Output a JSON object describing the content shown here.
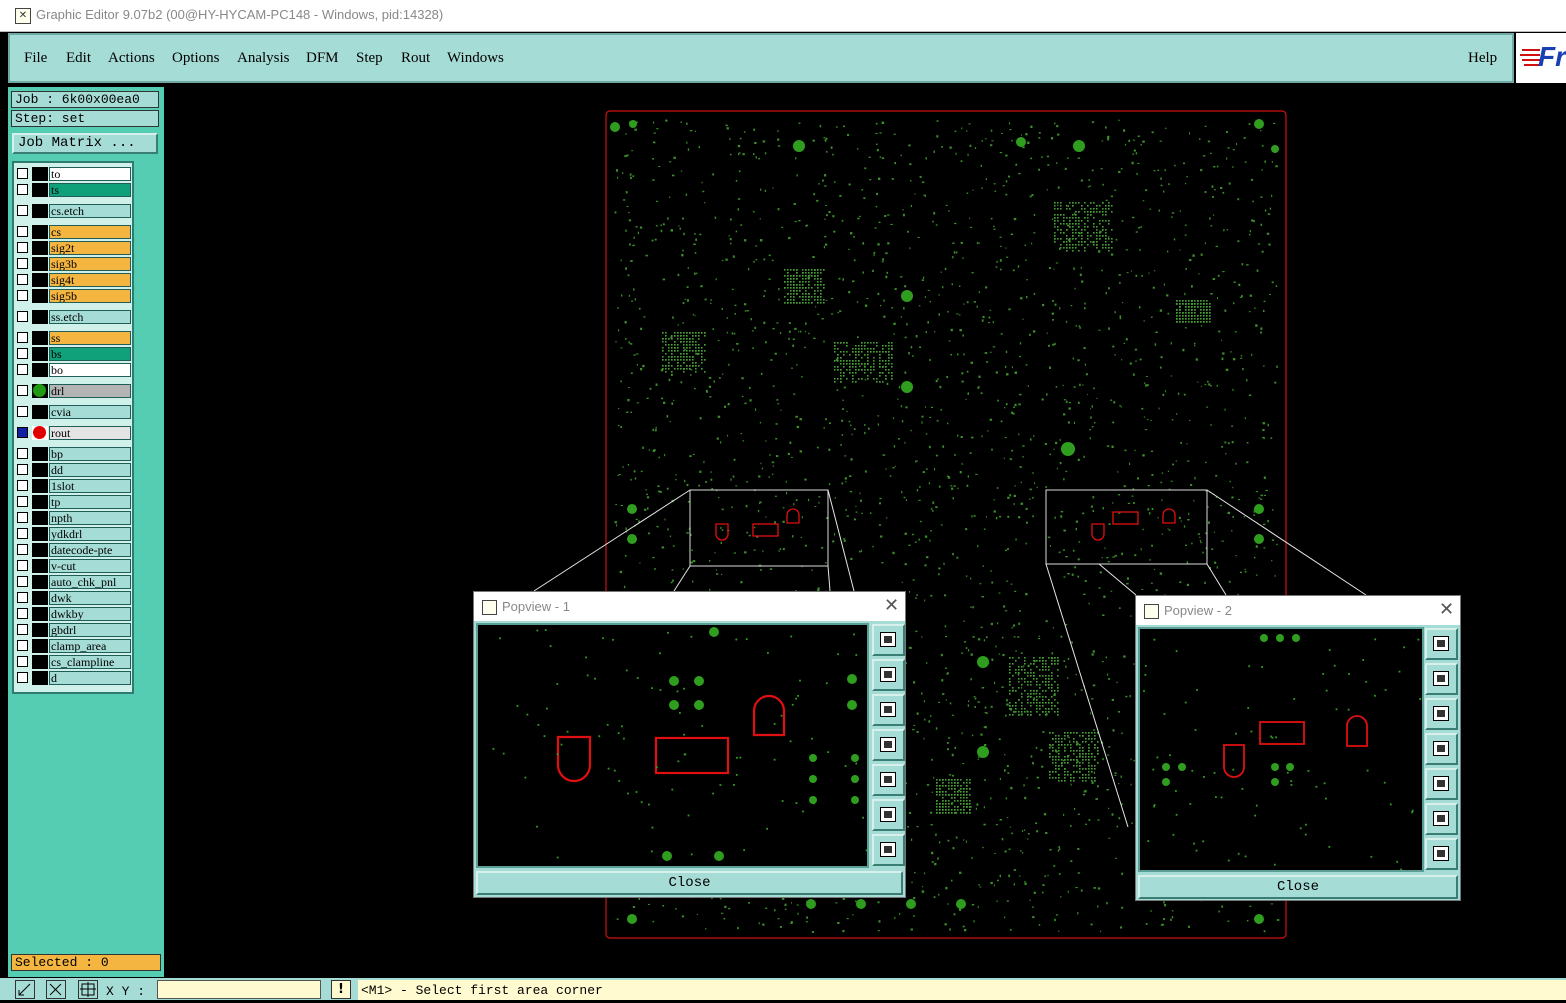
{
  "window": {
    "title": "Graphic Editor 9.07b2 (00@HY-HYCAM-PC148 - Windows, pid:14328)"
  },
  "menu": {
    "items": [
      "File",
      "Edit",
      "Actions",
      "Options",
      "Analysis",
      "DFM",
      "Step",
      "Rout",
      "Windows"
    ],
    "help": "Help"
  },
  "logo": {
    "text": "Fr"
  },
  "job": {
    "label": "Job : 6k00x00ea0",
    "step": "Step: set",
    "matrix_button": "Job Matrix ..."
  },
  "layers": [
    {
      "name": "to",
      "color": "#ffffff"
    },
    {
      "name": "ts",
      "color": "#10a07a"
    },
    {
      "name": "cs.etch",
      "color": "#a6dcd6"
    },
    {
      "name": "cs",
      "color": "#f4b640"
    },
    {
      "name": "sig2t",
      "color": "#f4b640"
    },
    {
      "name": "sig3b",
      "color": "#f4b640"
    },
    {
      "name": "sig4t",
      "color": "#f4b640"
    },
    {
      "name": "sig5b",
      "color": "#f4b640"
    },
    {
      "name": "ss.etch",
      "color": "#a6dcd6"
    },
    {
      "name": "ss",
      "color": "#f4b640"
    },
    {
      "name": "bs",
      "color": "#10a07a"
    },
    {
      "name": "bo",
      "color": "#ffffff"
    },
    {
      "name": "drl",
      "color": "#b4b4b4",
      "dot": "#1f9a12"
    },
    {
      "name": "cvia",
      "color": "#a6dcd6"
    },
    {
      "name": "rout",
      "color": "#e4e4e4",
      "dot": "#e00000",
      "active": true
    },
    {
      "name": "bp",
      "color": "#a6dcd6"
    },
    {
      "name": "dd",
      "color": "#a6dcd6"
    },
    {
      "name": "1slot",
      "color": "#a6dcd6"
    },
    {
      "name": "tp",
      "color": "#a6dcd6"
    },
    {
      "name": "npth",
      "color": "#a6dcd6"
    },
    {
      "name": "ydkdrl",
      "color": "#a6dcd6"
    },
    {
      "name": "datecode-pte",
      "color": "#a6dcd6"
    },
    {
      "name": "v-cut",
      "color": "#a6dcd6"
    },
    {
      "name": "auto_chk_pnl",
      "color": "#a6dcd6"
    },
    {
      "name": "dwk",
      "color": "#a6dcd6"
    },
    {
      "name": "dwkby",
      "color": "#a6dcd6"
    },
    {
      "name": "gbdrl",
      "color": "#a6dcd6"
    },
    {
      "name": "clamp_area",
      "color": "#a6dcd6"
    },
    {
      "name": "cs_clampline",
      "color": "#a6dcd6"
    },
    {
      "name": "d",
      "color": "#a6dcd6"
    }
  ],
  "status": {
    "selected": "Selected : 0",
    "xy_label": "X Y :",
    "message": "<M1> - Select first area corner"
  },
  "popviews": [
    {
      "title": "Popview - 1",
      "close_label": "Close"
    },
    {
      "title": "Popview - 2",
      "close_label": "Close"
    }
  ],
  "colors": {
    "panel": "#a6dcd6",
    "panel_dark": "#55cdb2",
    "board_outline": "#d01010",
    "pads": "#2f9e1e",
    "rout": "#e01010"
  }
}
